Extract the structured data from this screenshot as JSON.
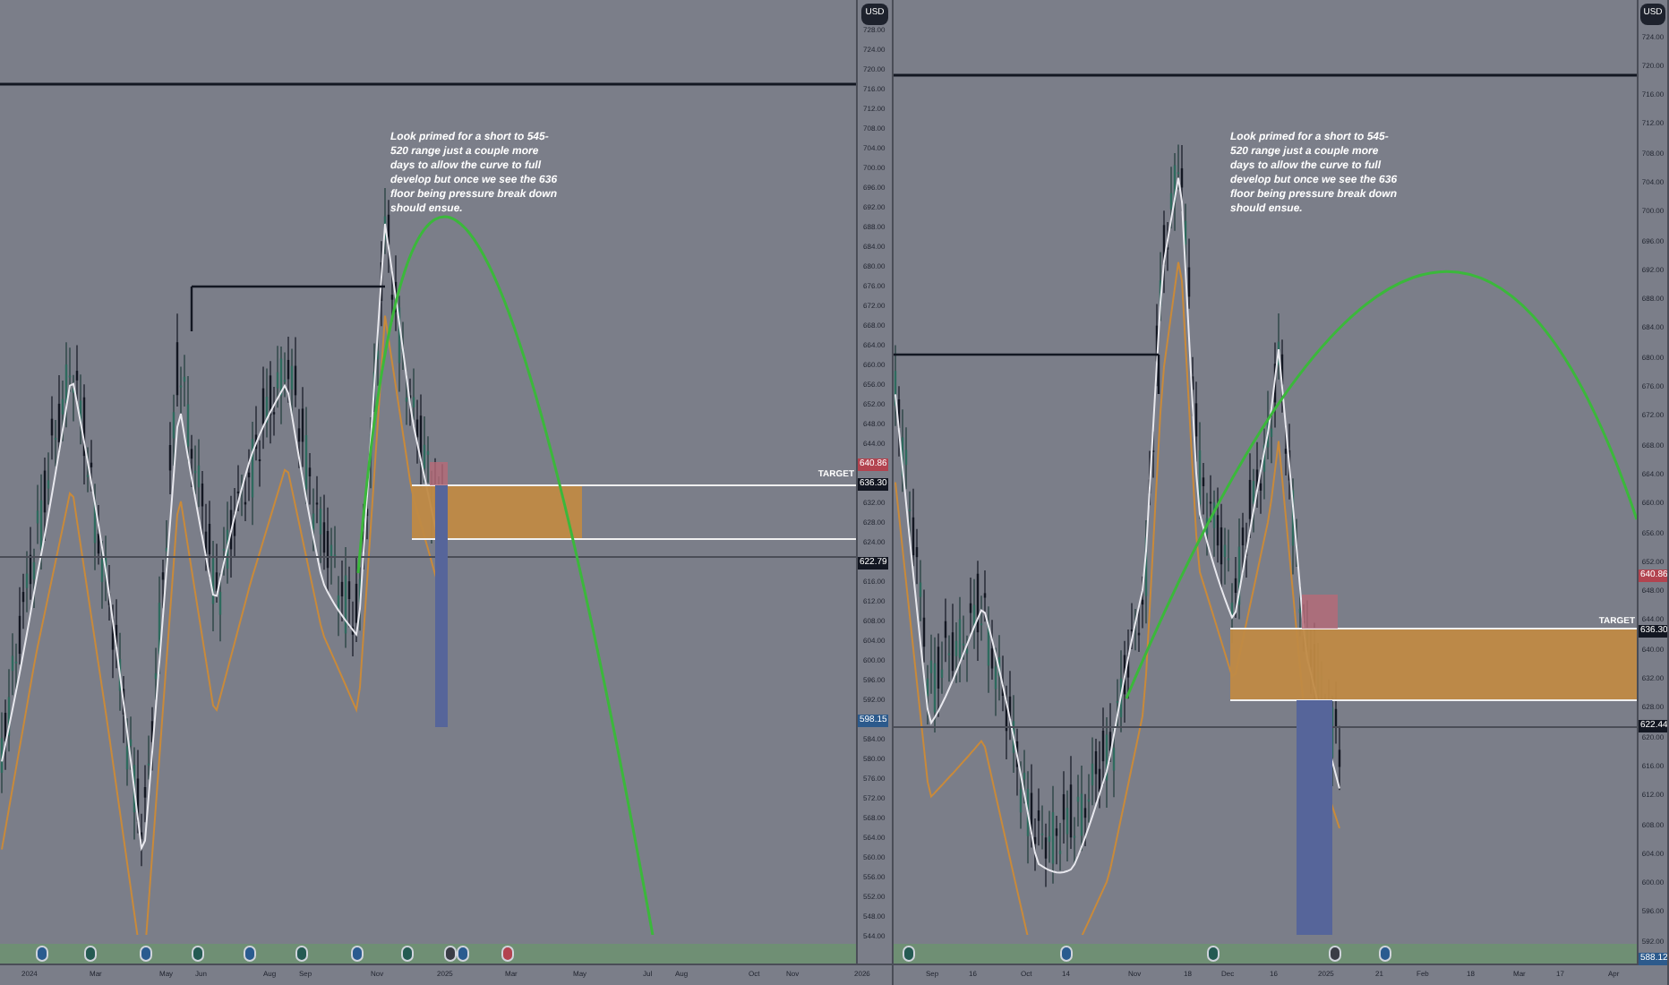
{
  "charts": [
    {
      "currency": "USD",
      "annotation": "Look primed for a short to 545-520 range just a couple more days to allow the curve to full develop but once we see the 636 floor being pressure break down should ensue.",
      "price_labels": [
        "728.00",
        "724.00",
        "720.00",
        "716.00",
        "712.00",
        "708.00",
        "704.00",
        "700.00",
        "696.00",
        "692.00",
        "688.00",
        "684.00",
        "680.00",
        "676.00",
        "672.00",
        "668.00",
        "664.00",
        "660.00",
        "656.00",
        "652.00",
        "648.00",
        "644.00",
        "632.00",
        "628.00",
        "624.00",
        "616.00",
        "612.00",
        "608.00",
        "604.00",
        "600.00",
        "596.00",
        "592.00",
        "584.00",
        "580.00",
        "576.00",
        "572.00",
        "568.00",
        "564.00",
        "560.00",
        "556.00",
        "552.00",
        "548.00",
        "544.00"
      ],
      "badges": [
        {
          "text": "640.86",
          "kind": "alert"
        },
        {
          "text": "636.30",
          "kind": "target",
          "label": "TARGET"
        },
        {
          "text": "622.79",
          "kind": "last"
        },
        {
          "text": "598.15",
          "kind": "level"
        }
      ],
      "time_labels": [
        "2024",
        "Mar",
        "May",
        "Jun",
        "Aug",
        "Sep",
        "Nov",
        "2025",
        "Mar",
        "May",
        "Jul",
        "Aug",
        "Oct",
        "Nov",
        "2026"
      ],
      "events": [
        {
          "kind": "dividend"
        },
        {
          "kind": "earnings"
        },
        {
          "kind": "dividend"
        },
        {
          "kind": "earnings"
        },
        {
          "kind": "dividend"
        },
        {
          "kind": "earnings"
        },
        {
          "kind": "dividend"
        },
        {
          "kind": "earnings"
        },
        {
          "kind": "split"
        },
        {
          "kind": "dividend"
        },
        {
          "kind": "alert"
        }
      ]
    },
    {
      "currency": "USD",
      "annotation": "Look primed for a short to 545-520 range just a couple more days to allow the curve to full develop but once we see the 636 floor being pressure break down should ensue.",
      "price_labels": [
        "724.00",
        "720.00",
        "716.00",
        "712.00",
        "708.00",
        "704.00",
        "700.00",
        "696.00",
        "692.00",
        "688.00",
        "684.00",
        "680.00",
        "676.00",
        "672.00",
        "668.00",
        "664.00",
        "660.00",
        "656.00",
        "652.00",
        "648.00",
        "644.00",
        "640.00",
        "632.00",
        "628.00",
        "620.00",
        "616.00",
        "612.00",
        "608.00",
        "604.00",
        "600.00",
        "596.00",
        "592.00"
      ],
      "badges": [
        {
          "text": "640.86",
          "kind": "alert"
        },
        {
          "text": "636.30",
          "kind": "target",
          "label": "TARGET"
        },
        {
          "text": "622.44",
          "kind": "last"
        },
        {
          "text": "588.12",
          "kind": "level"
        }
      ],
      "time_labels": [
        "Sep",
        "16",
        "Oct",
        "14",
        "Nov",
        "18",
        "Dec",
        "16",
        "2025",
        "21",
        "Feb",
        "18",
        "Mar",
        "17",
        "Apr"
      ],
      "events": [
        {
          "kind": "earnings"
        },
        {
          "kind": "dividend"
        },
        {
          "kind": "earnings"
        },
        {
          "kind": "split"
        },
        {
          "kind": "dividend"
        }
      ]
    }
  ]
}
